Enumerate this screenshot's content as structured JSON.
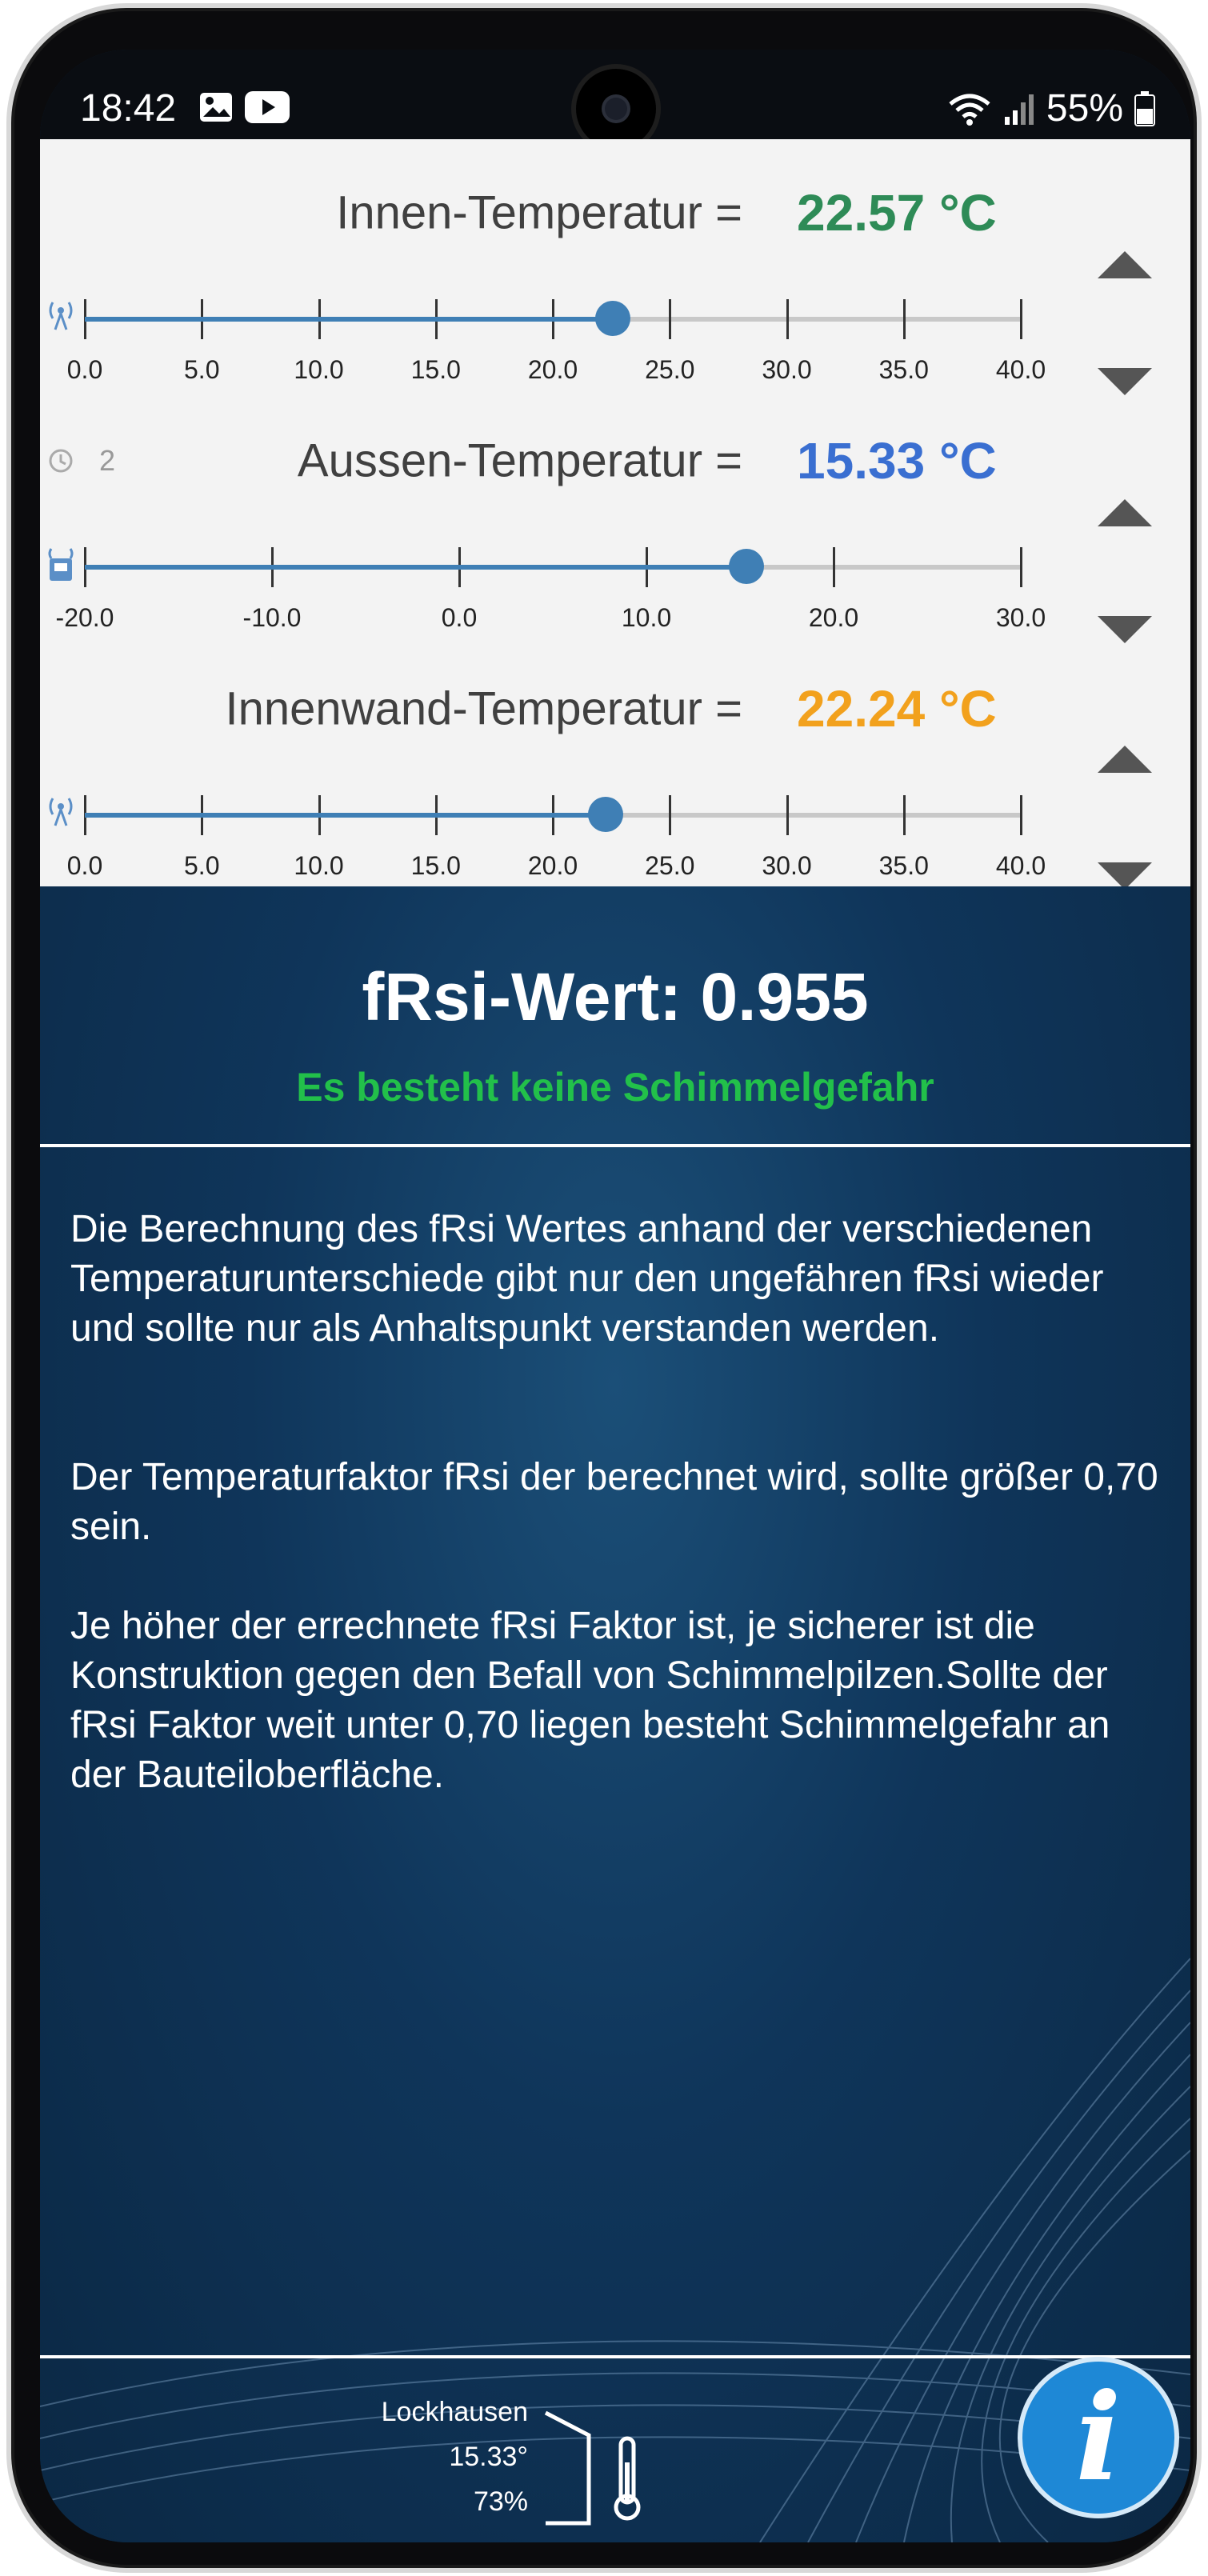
{
  "status_bar": {
    "time": "18:42",
    "battery": "55%",
    "icons": [
      "image-icon",
      "youtube-icon",
      "wifi-icon",
      "signal-icon",
      "battery-icon"
    ]
  },
  "innen": {
    "label": "Innen-Temperatur =",
    "value": "22.57 °C",
    "value_color": "#2e8b57",
    "slider_value": 22.57,
    "ticks": [
      "0.0",
      "5.0",
      "10.0",
      "15.0",
      "20.0",
      "25.0",
      "30.0",
      "35.0",
      "40.0"
    ]
  },
  "aussen": {
    "label": "Aussen-Temperatur =",
    "value": "15.33 °C",
    "value_color": "#3a6fd1",
    "history_count": "2",
    "slider_value": 15.33,
    "ticks": [
      "-20.0",
      "-10.0",
      "0.0",
      "10.0",
      "20.0",
      "30.0"
    ]
  },
  "innenwand": {
    "label": "Innenwand-Temperatur =",
    "value": "22.24 °C",
    "value_color": "#f2a11d",
    "slider_value": 22.24,
    "ticks": [
      "0.0",
      "5.0",
      "10.0",
      "15.0",
      "20.0",
      "25.0",
      "30.0",
      "35.0",
      "40.0"
    ]
  },
  "result": {
    "frsi": "fRsi-Wert: 0.955",
    "status": "Es besteht keine Schimmelgefahr",
    "status_color": "#22c04a"
  },
  "description": {
    "p1": "Die Berechnung des fRsi Wertes anhand der verschiedenen Temperaturunterschiede gibt nur den ungefähren fRsi wieder und sollte nur als Anhaltspunkt verstanden werden.",
    "p2": "Der Temperaturfaktor fRsi der berechnet wird, sollte größer 0,70 sein.",
    "p3": "Je höher der errechnete fRsi Faktor ist, je sicherer ist die Konstruktion gegen den Befall von Schimmelpilzen.Sollte der fRsi Faktor weit unter 0,70 liegen besteht Schimmelgefahr an der Bauteiloberfläche."
  },
  "weather": {
    "location": "Lockhausen",
    "temperature": "15.33°",
    "humidity": "73%"
  },
  "info_button": {
    "label": "i"
  }
}
